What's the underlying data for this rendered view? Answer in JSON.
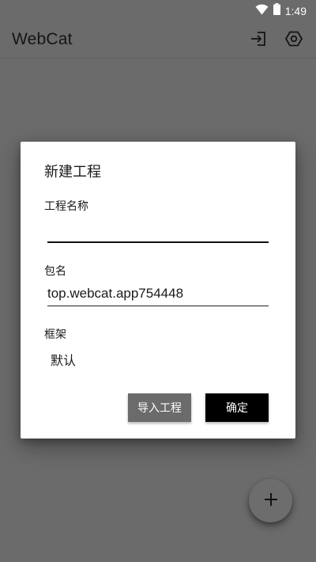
{
  "status_bar": {
    "time": "1:49",
    "icons": [
      "wifi-icon",
      "battery-icon"
    ]
  },
  "app_bar": {
    "title": "WebCat",
    "icons": [
      "exit-to-app-icon",
      "settings-icon"
    ]
  },
  "dialog": {
    "title": "新建工程",
    "project_name": {
      "label": "工程名称",
      "value": ""
    },
    "package_name": {
      "label": "包名",
      "value": "top.webcat.app754448"
    },
    "framework": {
      "label": "框架",
      "value": "默认"
    },
    "buttons": {
      "import": "导入工程",
      "ok": "确定"
    }
  },
  "fab": {
    "icon": "add-icon"
  },
  "colors": {
    "scrim_background": "#6b6b6b",
    "dialog_background": "#ffffff",
    "primary_button": "#000000",
    "secondary_button": "#6b6b6b"
  }
}
